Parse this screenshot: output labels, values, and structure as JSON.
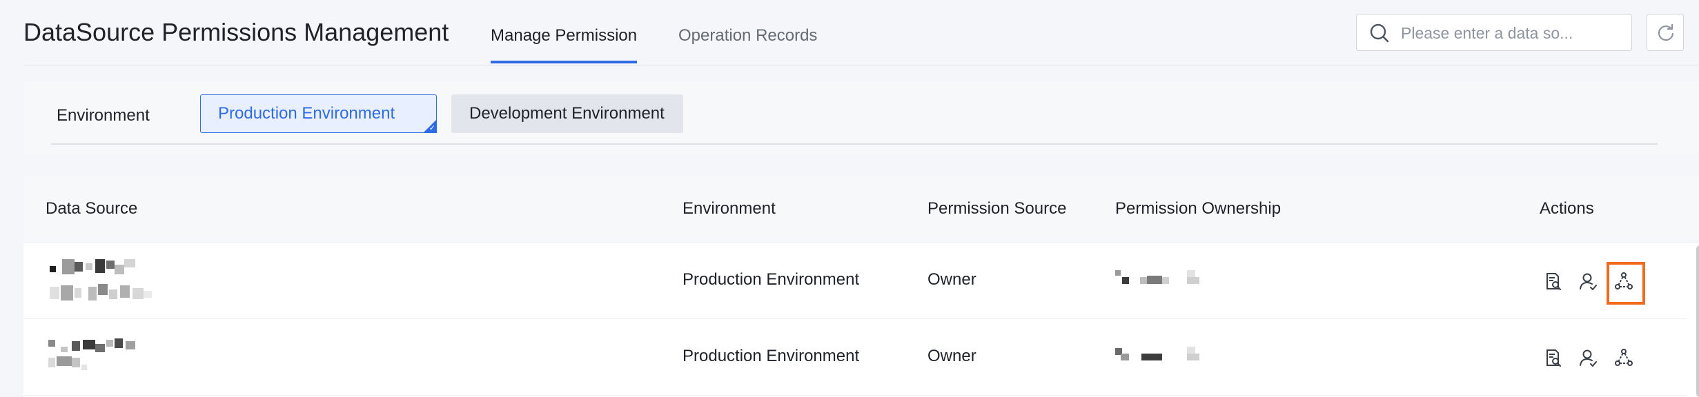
{
  "header": {
    "title": "DataSource Permissions Management",
    "tabs": [
      {
        "label": "Manage Permission",
        "active": true
      },
      {
        "label": "Operation Records",
        "active": false
      }
    ],
    "search": {
      "placeholder": "Please enter a data so...",
      "value": "",
      "icon": "search-icon"
    },
    "refresh_icon": "refresh-icon"
  },
  "filter": {
    "label": "Environment",
    "options": [
      {
        "label": "Production Environment",
        "selected": true
      },
      {
        "label": "Development Environment",
        "selected": false
      }
    ]
  },
  "table": {
    "columns": [
      "Data Source",
      "Environment",
      "Permission Source",
      "Permission Ownership",
      "Actions"
    ],
    "rows": [
      {
        "data_source": "",
        "environment": "Production Environment",
        "permission_source": "Owner",
        "permission_ownership": "",
        "actions": [
          "view-details-icon",
          "user-permission-icon",
          "share-icon"
        ]
      },
      {
        "data_source": "",
        "environment": "Production Environment",
        "permission_source": "Owner",
        "permission_ownership": "",
        "actions": [
          "view-details-icon",
          "user-permission-icon",
          "share-icon"
        ]
      }
    ],
    "highlighted_action": "row-1-share-icon"
  },
  "colors": {
    "accent": "#2f6be6",
    "highlight": "#f26b1d",
    "selected_bg": "#e8efff",
    "text_primary": "#1f2329",
    "text_secondary": "#646a73"
  }
}
